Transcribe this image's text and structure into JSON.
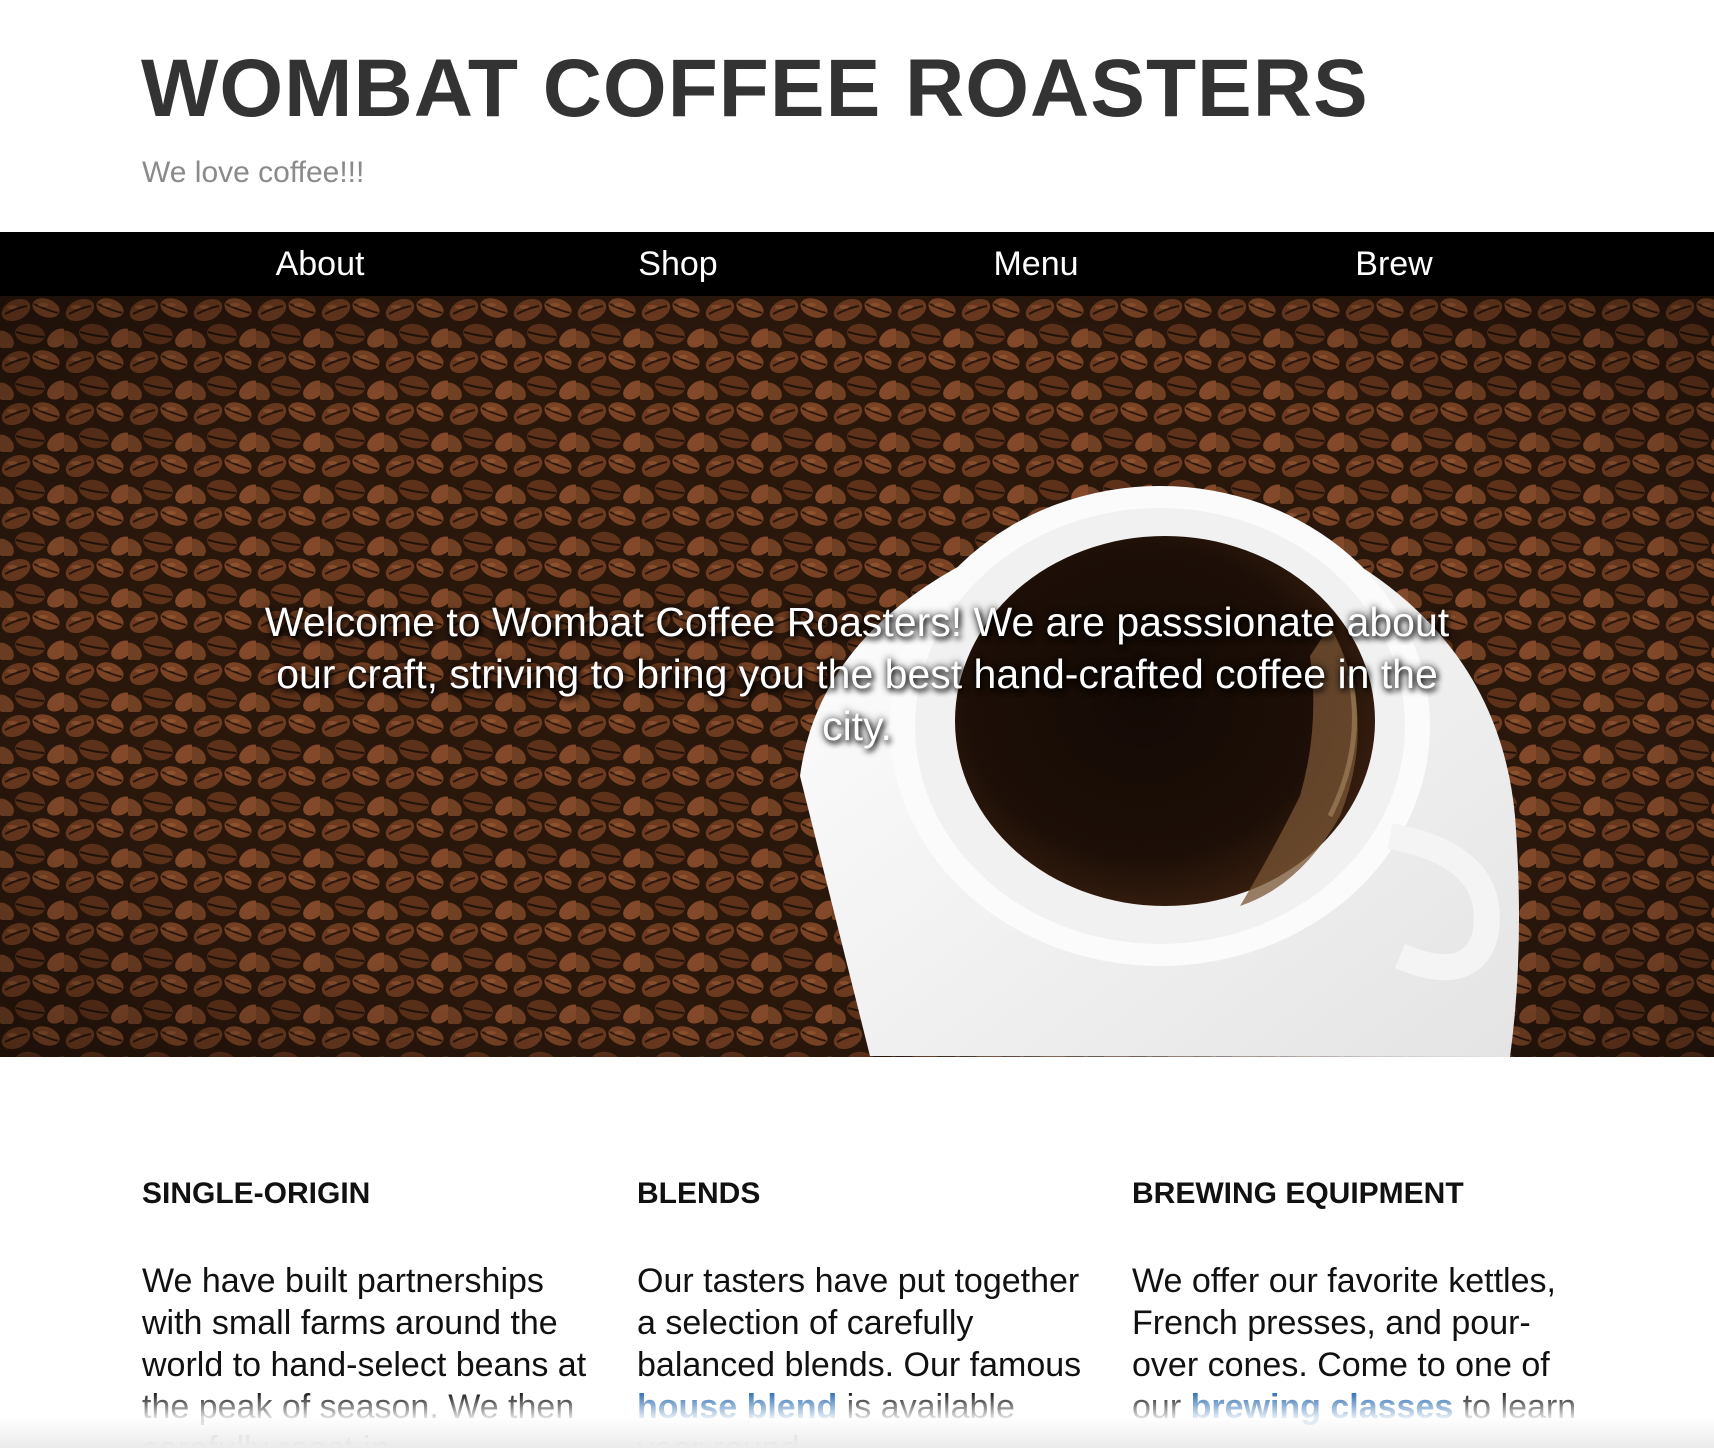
{
  "header": {
    "title": "WOMBAT COFFEE ROASTERS",
    "tagline": "We love coffee!!!"
  },
  "nav": {
    "items": [
      {
        "label": "About"
      },
      {
        "label": "Shop"
      },
      {
        "label": "Menu"
      },
      {
        "label": "Brew"
      }
    ]
  },
  "hero": {
    "text": "Welcome to Wombat Coffee Roasters! We are passsionate about our craft, striving to bring you the best hand-crafted coffee in the city."
  },
  "features": [
    {
      "heading": "SINGLE-ORIGIN",
      "text_before": "We have built partnerships with small farms around the world to hand-select beans at the peak of season. We then carefully roast in",
      "link": "",
      "text_after": ""
    },
    {
      "heading": "BLENDS",
      "text_before": "Our tasters have put together a selection of carefully balanced blends. Our famous ",
      "link": "house blend",
      "text_after": " is available year round"
    },
    {
      "heading": "BREWING EQUIPMENT",
      "text_before": "We offer our favorite kettles, French presses, and pour-over cones. Come to one of our ",
      "link": "brewing classes",
      "text_after": " to learn"
    }
  ],
  "colors": {
    "title": "#333333",
    "tagline": "#8a8a8a",
    "nav_background": "#000000",
    "nav_text": "#ffffff",
    "link": "#2f6fb3"
  }
}
